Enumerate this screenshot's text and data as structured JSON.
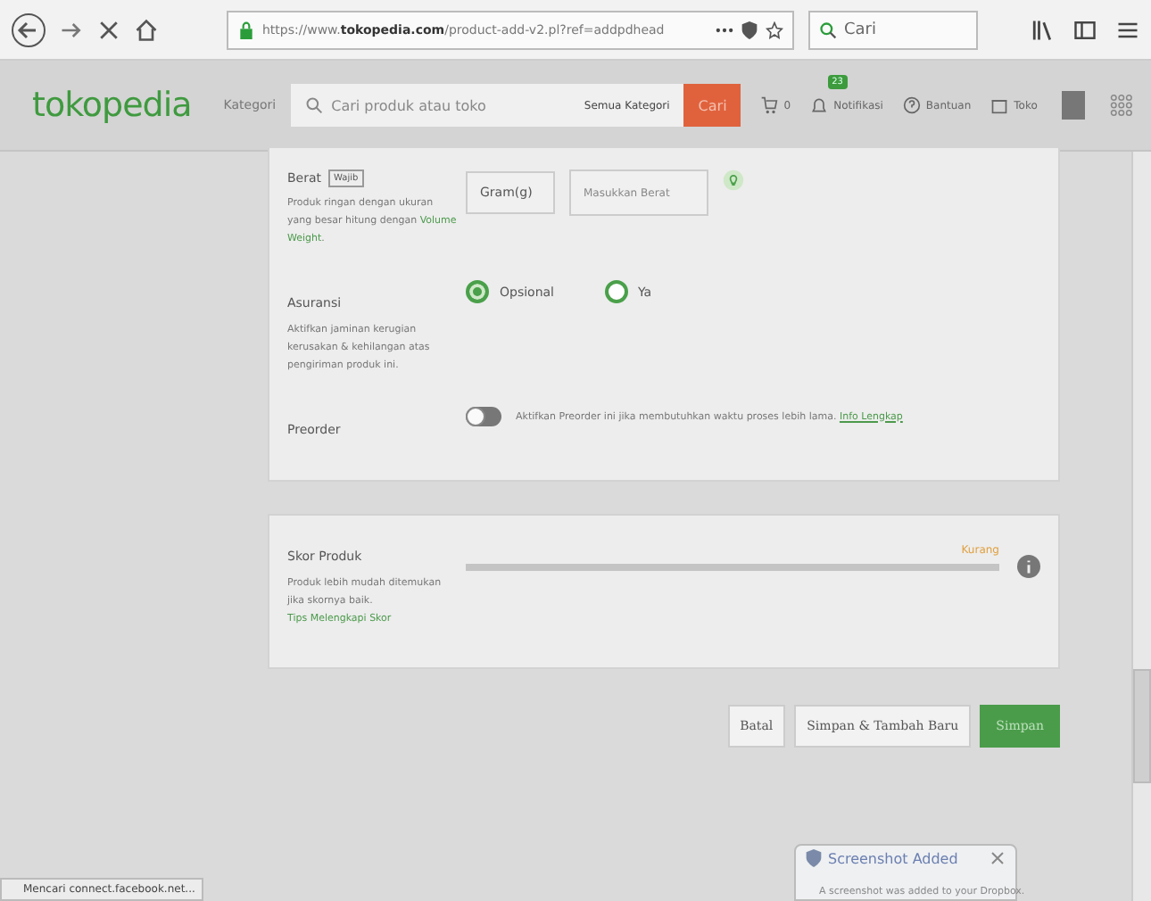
{
  "browser": {
    "url_prefix": "https://www.",
    "url_domain": "tokopedia.com",
    "url_rest": "/product-add-v2.pl?ref=addpdhead",
    "search_placeholder": "Cari"
  },
  "header": {
    "logo": "tokopedia",
    "category_menu": "Kategori",
    "search_placeholder": "Cari produk atau toko",
    "search_scope": "Semua Kategori",
    "search_button": "Cari",
    "cart_count": "0",
    "notifications": "Notifikasi",
    "notification_badge": "23",
    "help": "Bantuan",
    "shop": "Toko"
  },
  "weight": {
    "label": "Berat",
    "tag": "Wajib",
    "help": "Produk ringan dengan ukuran yang besar hitung dengan **Volume Weight**.",
    "unit": "Gram(g)",
    "placeholder": "Masukkan Berat"
  },
  "insurance": {
    "label": "Asuransi",
    "help": "Aktifkan jaminan kerugian kerusakan & kehilangan atas pengiriman produk ini.",
    "options": [
      {
        "label": "Opsional",
        "selected": true
      },
      {
        "label": "Ya",
        "selected": false
      }
    ]
  },
  "preorder": {
    "label": "Preorder",
    "on": false,
    "text": "Aktifkan Preorder ini jika membutuhkan waktu proses lebih lama.",
    "link": "Info Lengkap"
  },
  "score": {
    "title": "Skor Produk",
    "help": "Produk lebih mudah ditemukan jika skornya baik.",
    "link": "Tips Melengkapi Skor",
    "rating": "Kurang"
  },
  "buttons": [
    {
      "label": "Batal",
      "kind": "plain"
    },
    {
      "label": "Simpan & Tambah Baru",
      "kind": "plain"
    },
    {
      "label": "Simpan",
      "kind": "primary"
    }
  ],
  "toast": {
    "title": "Screenshot Added",
    "text": "A screenshot was added to your Dropbox."
  },
  "status_bar": "Mencari connect.facebook.net..."
}
